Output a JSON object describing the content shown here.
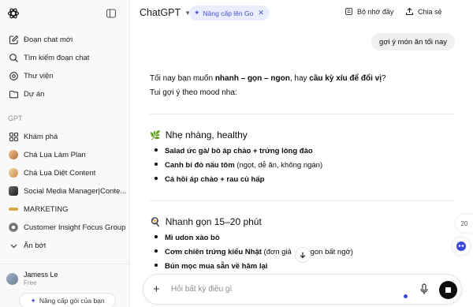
{
  "colors": {
    "accent": "#4451d6",
    "pill_bg": "#eaedfd",
    "sidebar_bg": "#f9f9f9",
    "user_bubble": "#f0f0f0"
  },
  "sidebar": {
    "top_items": [
      {
        "icon": "new-chat-icon",
        "label": "Đoạn chat mới"
      },
      {
        "icon": "search-icon",
        "label": "Tìm kiếm đoạn chat"
      },
      {
        "icon": "library-icon",
        "label": "Thư viện"
      },
      {
        "icon": "folder-icon",
        "label": "Dự án"
      }
    ],
    "section_label": "GPT",
    "gpt_items": [
      {
        "icon": "explore-icon",
        "label": "Khám phá"
      },
      {
        "icon": "gpt-avatar",
        "label": "Chá Lụa Làm Plan"
      },
      {
        "icon": "gpt-avatar",
        "label": "Chá Lụa Diệt Content"
      },
      {
        "icon": "gpt-avatar",
        "label": "Social Media Manager|Conte..."
      },
      {
        "icon": "gpt-avatar",
        "label": "MARKETING"
      },
      {
        "icon": "gpt-avatar",
        "label": "Customer Insight Focus Group"
      },
      {
        "icon": "hide-icon",
        "label": "Ẩn bớt"
      }
    ],
    "user": {
      "name": "Jamess Le",
      "plan": "Free"
    },
    "upgrade_label": "Nâng cấp gói của bạn"
  },
  "header": {
    "model": "ChatGPT",
    "go_pill": "Nâng cấp lên Go",
    "memory_label": "Bộ nhớ đầy",
    "share_label": "Chia sẻ"
  },
  "chat": {
    "user_message": "gợi ý món ăn tối nay",
    "intro": {
      "p1_a": "Tối nay bạn muốn ",
      "p1_b": "nhanh – gọn – ngon",
      "p1_c": ", hay ",
      "p1_d": "cầu kỳ xíu để đổi vị",
      "p1_e": "?",
      "p2": "Tui gợi ý theo mood nha:"
    },
    "sections": [
      {
        "emoji": "🌿",
        "title": "Nhẹ nhàng, healthy",
        "items": [
          {
            "bold": "Salad ức gà/ bò áp chảo + trứng lòng đào",
            "rest": ""
          },
          {
            "bold": "Canh bí đỏ nấu tôm",
            "rest": " (ngọt, dễ ăn, không ngán)"
          },
          {
            "bold": "Cá hồi áp chảo + rau củ hấp",
            "rest": ""
          }
        ]
      },
      {
        "emoji": "🍳",
        "title": "Nhanh gọn 15–20 phút",
        "items": [
          {
            "bold": "Mì udon xào bò",
            "rest": ""
          },
          {
            "bold": "Cơm chiên trứng kiểu Nhật",
            "rest": " (đơn giả    à ngon bất ngờ)"
          },
          {
            "bold": "Bún mọc mua sẵn về hâm lại",
            "rest": ""
          }
        ]
      }
    ]
  },
  "composer": {
    "placeholder": "Hỏi bất kỳ điều gì"
  },
  "side_widget": {
    "badge": "20"
  }
}
